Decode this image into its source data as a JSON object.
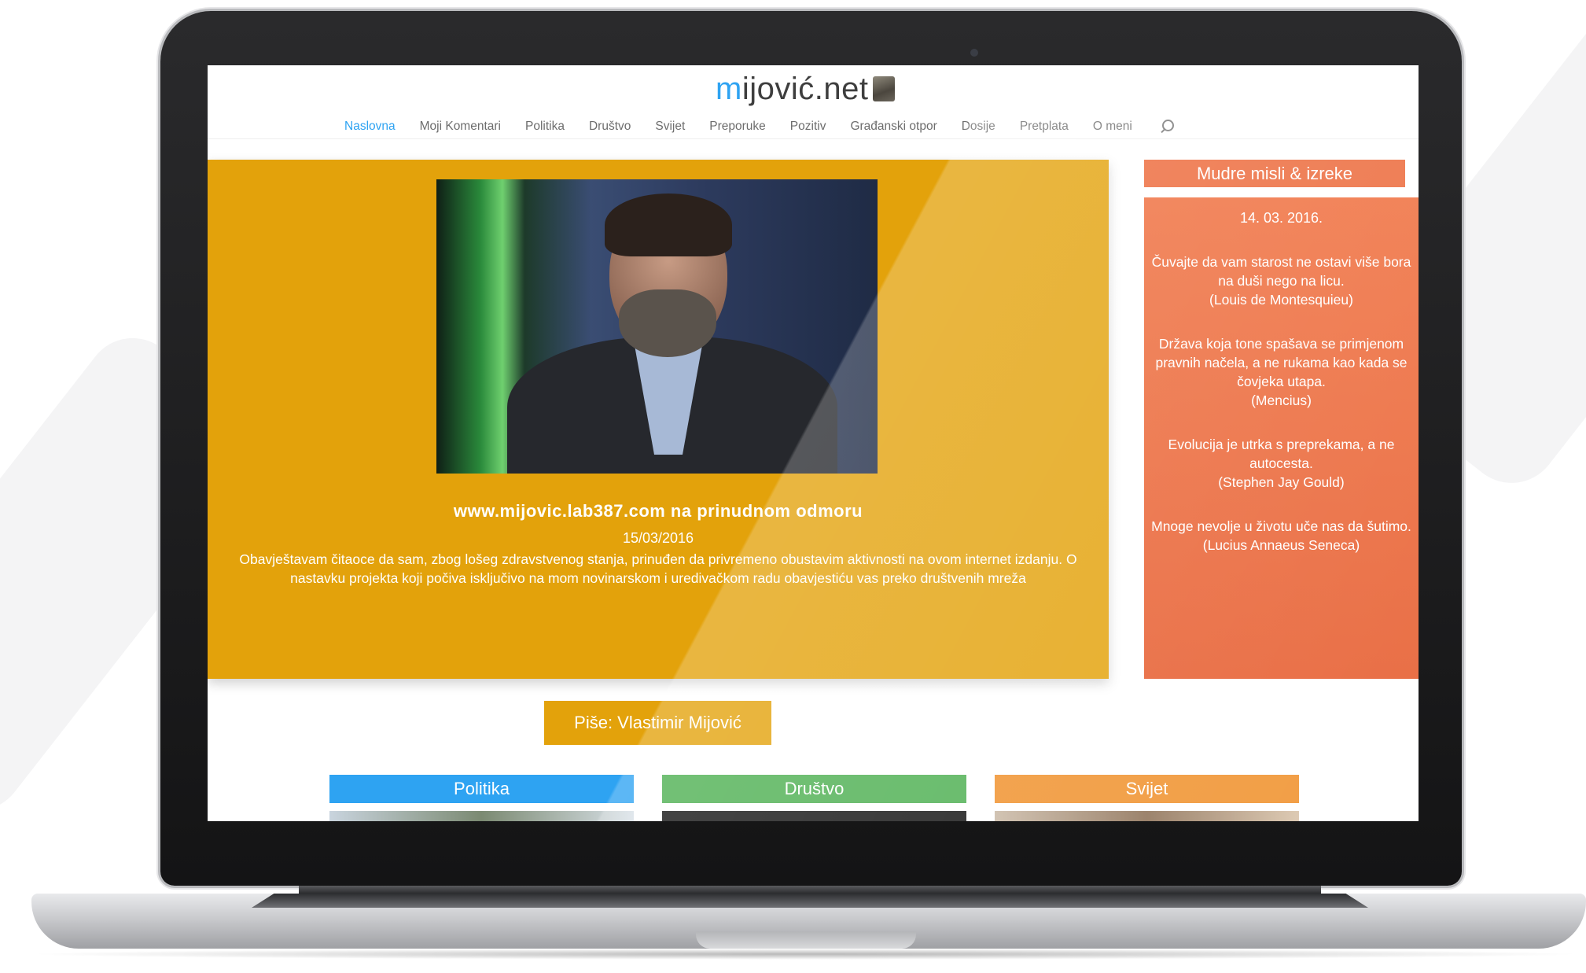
{
  "site": {
    "logo_text": "mijović.net",
    "logo_accent_letter": "m",
    "logo_rest": "ijović.net"
  },
  "nav": {
    "items": [
      {
        "label": "Naslovna",
        "active": true
      },
      {
        "label": "Moji Komentari"
      },
      {
        "label": "Politika"
      },
      {
        "label": "Društvo"
      },
      {
        "label": "Svijet"
      },
      {
        "label": "Preporuke"
      },
      {
        "label": "Pozitiv"
      },
      {
        "label": "Građanski otpor"
      },
      {
        "label": "Dosije"
      },
      {
        "label": "Pretplata"
      },
      {
        "label": "O meni"
      }
    ],
    "search_icon": "search-icon"
  },
  "featured": {
    "title": "www.mijovic.lab387.com na prinudnom odmoru",
    "date": "15/03/2016",
    "excerpt": "Obavještavam čitaoce da sam, zbog lošeg zdravstvenog stanja, prinuđen da privremeno obustavim aktivnosti na ovom internet izdanju. O nastavku projekta koji počiva isključivo na mom novinarskom i uredivačkom radu obavjestiću vas preko društvenih mreža"
  },
  "sidebar": {
    "title": "Mudre misli & izreke",
    "date": "14. 03. 2016.",
    "quotes": [
      {
        "text": "Čuvajte da vam starost ne ostavi više bora na duši nego na licu.",
        "author": "(Louis de Montesquieu)"
      },
      {
        "text": "Država koja tone spašava se primjenom pravnih načela, a ne rukama kao kada se čovjeka utapa.",
        "author": "(Mencius)"
      },
      {
        "text": "Evolucija je utrka s preprekama, a ne autocesta.",
        "author": "(Stephen Jay Gould)"
      },
      {
        "text": "Mnoge nevolje u životu uče nas da šutimo.",
        "author": "(Lucius Annaeus Seneca)"
      }
    ]
  },
  "author_button": "Piše: Vlastimir Mijović",
  "categories": [
    {
      "label": "Politika",
      "color": "#2ea3f2"
    },
    {
      "label": "Društvo",
      "color": "#4caf50"
    },
    {
      "label": "Svijet",
      "color": "#f0902a"
    }
  ],
  "colors": {
    "accent": "#2ea3f2",
    "featured_bg": "#e3a20b",
    "sidebar_bg": "#ec6737"
  }
}
